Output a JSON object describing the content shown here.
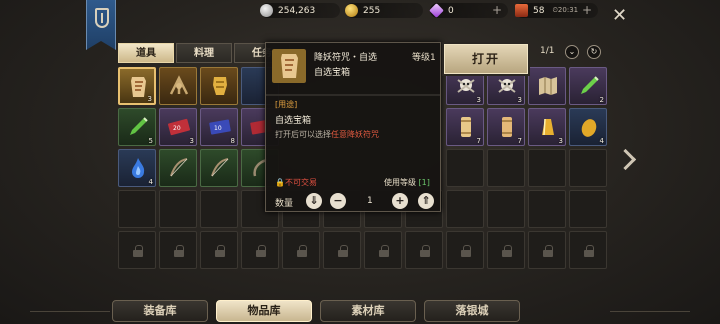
{
  "resources": [
    {
      "icon": "silver-coin-icon",
      "value": "254,263",
      "plus": false
    },
    {
      "icon": "gold-coin-icon",
      "value": "255",
      "plus": false
    },
    {
      "icon": "diamond-icon",
      "value": "0",
      "plus": true
    },
    {
      "icon": "ticket-icon",
      "value": "58",
      "time": "20:31",
      "plus": true
    }
  ],
  "tabs": [
    "道具",
    "料理",
    "任务"
  ],
  "pager": "1/1",
  "tooltip": {
    "name": "降妖符咒・自选",
    "level": "等级1",
    "subtitle": "自选宝箱",
    "use_header": "[用途]",
    "use_text": "自选宝箱",
    "desc_prefix": "打开后可以选择",
    "desc_highlight": "任意降妖符咒",
    "not_tradeable": "不可交易",
    "use_level_label": "使用等级",
    "use_level_value": "[1]",
    "qty_label": "数量",
    "qty_value": "1"
  },
  "open_button": "打开",
  "bottom_tabs": [
    "装备库",
    "物品库",
    "素材库",
    "落银城"
  ],
  "active_bottom_tab": 1,
  "colors": {
    "accent": "#e8d6a8",
    "red_text": "#e05040",
    "green_text": "#6ac46a"
  }
}
